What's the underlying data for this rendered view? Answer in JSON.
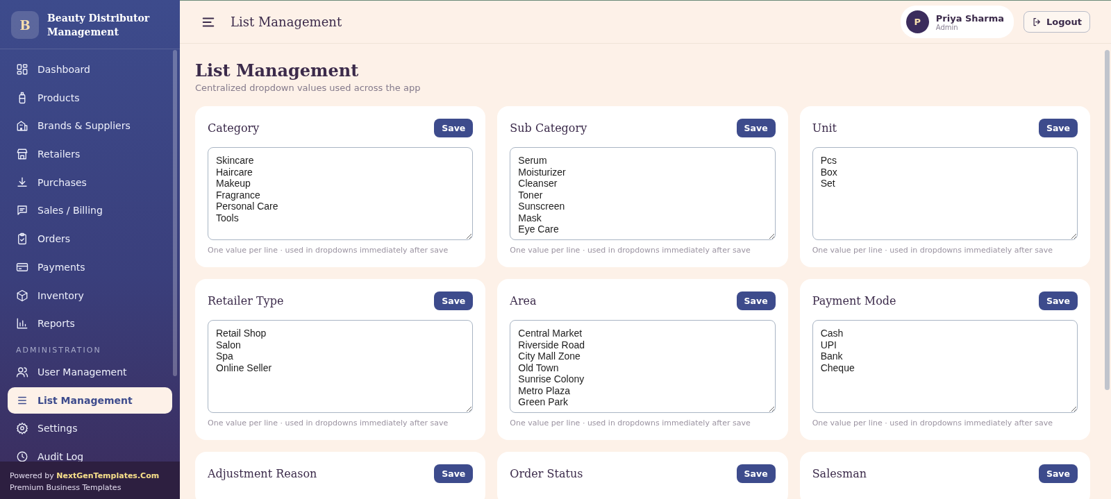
{
  "brand": {
    "logo_letter": "B",
    "name": "Beauty Distributor Management"
  },
  "sidebar": {
    "sections": [
      {
        "items": [
          {
            "label": "Dashboard",
            "selected": false
          },
          {
            "label": "Products",
            "selected": false
          },
          {
            "label": "Brands & Suppliers",
            "selected": false
          },
          {
            "label": "Retailers",
            "selected": false
          },
          {
            "label": "Purchases",
            "selected": false
          },
          {
            "label": "Sales / Billing",
            "selected": false
          },
          {
            "label": "Orders",
            "selected": false
          },
          {
            "label": "Payments",
            "selected": false
          },
          {
            "label": "Inventory",
            "selected": false
          },
          {
            "label": "Reports",
            "selected": false
          }
        ]
      },
      {
        "heading": "ADMINISTRATION",
        "items": [
          {
            "label": "User Management",
            "selected": false
          },
          {
            "label": "List Management",
            "selected": true
          },
          {
            "label": "Settings",
            "selected": false
          },
          {
            "label": "Audit Log",
            "selected": false
          }
        ]
      }
    ]
  },
  "footer": {
    "prefix": "Powered by ",
    "link": "NextGenTemplates.Com",
    "tagline": "Premium Business Templates"
  },
  "header": {
    "title": "List Management",
    "user": {
      "initial": "P",
      "name": "Priya Sharma",
      "role": "Admin"
    },
    "logout": "Logout"
  },
  "page": {
    "title": "List Management",
    "subtitle": "Centralized dropdown values used across the app"
  },
  "lists": [
    {
      "title": "Category",
      "save": "Save",
      "values": [
        "Skincare",
        "Haircare",
        "Makeup",
        "Fragrance",
        "Personal Care",
        "Tools"
      ],
      "hint": "One value per line · used in dropdowns immediately after save"
    },
    {
      "title": "Sub Category",
      "save": "Save",
      "values": [
        "Serum",
        "Moisturizer",
        "Cleanser",
        "Toner",
        "Sunscreen",
        "Mask",
        "Eye Care"
      ],
      "hint": "One value per line · used in dropdowns immediately after save"
    },
    {
      "title": "Unit",
      "save": "Save",
      "values": [
        "Pcs",
        "Box",
        "Set"
      ],
      "hint": "One value per line · used in dropdowns immediately after save"
    },
    {
      "title": "Retailer Type",
      "save": "Save",
      "values": [
        "Retail Shop",
        "Salon",
        "Spa",
        "Online Seller"
      ],
      "hint": "One value per line · used in dropdowns immediately after save"
    },
    {
      "title": "Area",
      "save": "Save",
      "values": [
        "Central Market",
        "Riverside Road",
        "City Mall Zone",
        "Old Town",
        "Sunrise Colony",
        "Metro Plaza",
        "Green Park"
      ],
      "hint": "One value per line · used in dropdowns immediately after save"
    },
    {
      "title": "Payment Mode",
      "save": "Save",
      "values": [
        "Cash",
        "UPI",
        "Bank",
        "Cheque"
      ],
      "hint": "One value per line · used in dropdowns immediately after save"
    },
    {
      "title": "Adjustment Reason",
      "save": "Save"
    },
    {
      "title": "Order Status",
      "save": "Save"
    },
    {
      "title": "Salesman",
      "save": "Save"
    }
  ]
}
